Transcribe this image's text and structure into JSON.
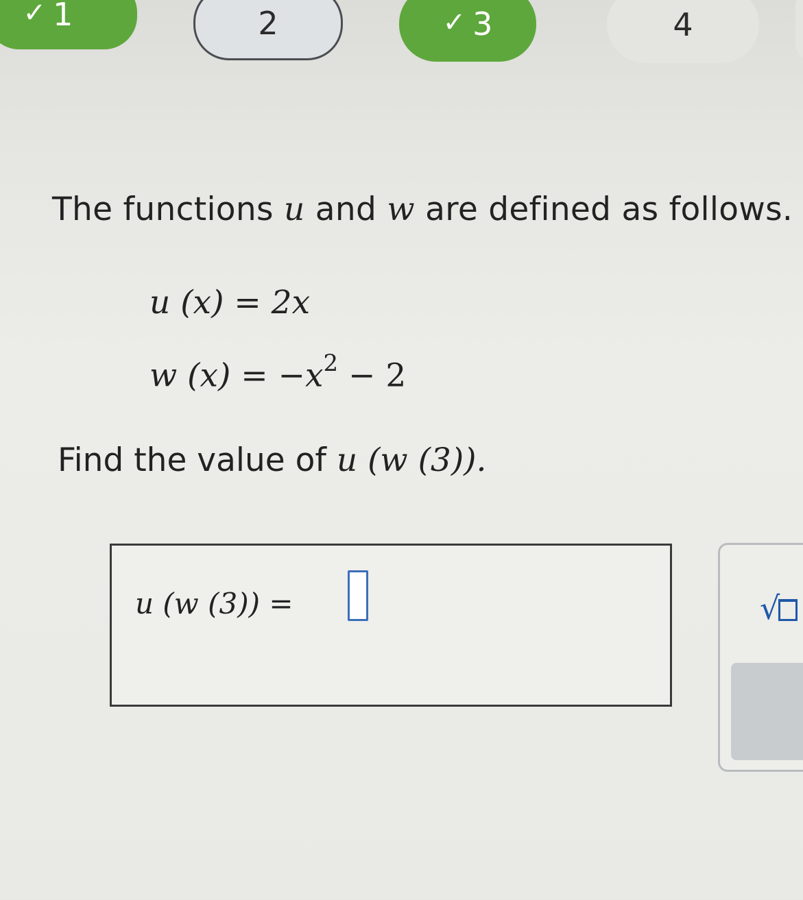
{
  "steps": [
    {
      "label": "1",
      "status": "complete"
    },
    {
      "label": "2",
      "status": "current"
    },
    {
      "label": "3",
      "status": "complete"
    },
    {
      "label": "4",
      "status": "upcoming"
    },
    {
      "label": "",
      "status": "upcoming"
    }
  ],
  "question": {
    "intro_prefix": "The functions ",
    "var_u": "u",
    "intro_and": " and ",
    "var_w": "w",
    "intro_suffix": " are defined as follows.",
    "u_def_lhs": "u",
    "u_def_rest": " (x) = 2x",
    "w_def_lhs": "w",
    "w_def_rest": " (x) = −x",
    "w_def_exp": "2",
    "w_def_tail": " − 2",
    "prompt_prefix": "Find the value of ",
    "prompt_expr": "u (w (3)).",
    "answer_lhs": "u (w (3)) ="
  },
  "answer": {
    "value": "",
    "placeholder": ""
  },
  "tools": {
    "sqrt_symbol": "√"
  },
  "colors": {
    "complete": "#5ea73c",
    "current_border": "#4a4e52",
    "input_border": "#3b6fb8",
    "tool_icon": "#1f58a8"
  }
}
